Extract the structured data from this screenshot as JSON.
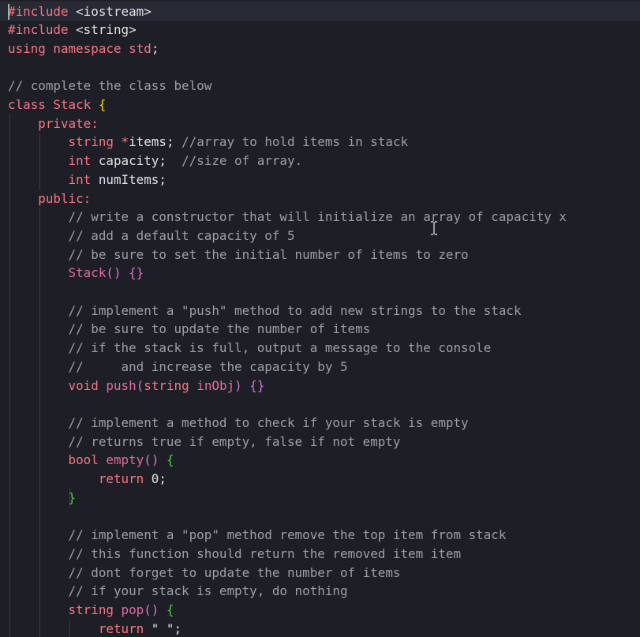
{
  "editor": {
    "language": "cpp",
    "lines": [
      [
        {
          "t": "#include",
          "c": "pp"
        },
        {
          "t": " <iostream>",
          "c": "id"
        }
      ],
      [
        {
          "t": "#include",
          "c": "pp"
        },
        {
          "t": " <string>",
          "c": "id"
        }
      ],
      [
        {
          "t": "using",
          "c": "kw"
        },
        {
          "t": " ",
          "c": "id"
        },
        {
          "t": "namespace",
          "c": "kw"
        },
        {
          "t": " ",
          "c": "id"
        },
        {
          "t": "std",
          "c": "cls"
        },
        {
          "t": ";",
          "c": "pun"
        }
      ],
      [],
      [
        {
          "t": "// complete the class below",
          "c": "com"
        }
      ],
      [
        {
          "t": "class",
          "c": "kw"
        },
        {
          "t": " ",
          "c": "id"
        },
        {
          "t": "Stack",
          "c": "cls"
        },
        {
          "t": " ",
          "c": "id"
        },
        {
          "t": "{",
          "c": "br1"
        }
      ],
      [
        {
          "t": "    ",
          "c": "id"
        },
        {
          "t": "private:",
          "c": "kw"
        }
      ],
      [
        {
          "t": "        ",
          "c": "id"
        },
        {
          "t": "string",
          "c": "type"
        },
        {
          "t": " ",
          "c": "id"
        },
        {
          "t": "*",
          "c": "op"
        },
        {
          "t": "items",
          "c": "id"
        },
        {
          "t": "; ",
          "c": "pun"
        },
        {
          "t": "//array to hold items in stack",
          "c": "com"
        }
      ],
      [
        {
          "t": "        ",
          "c": "id"
        },
        {
          "t": "int",
          "c": "type"
        },
        {
          "t": " capacity",
          "c": "id"
        },
        {
          "t": ";  ",
          "c": "pun"
        },
        {
          "t": "//size of array.",
          "c": "com"
        }
      ],
      [
        {
          "t": "        ",
          "c": "id"
        },
        {
          "t": "int",
          "c": "type"
        },
        {
          "t": " numItems",
          "c": "id"
        },
        {
          "t": ";",
          "c": "pun"
        }
      ],
      [
        {
          "t": "    ",
          "c": "id"
        },
        {
          "t": "public:",
          "c": "kw"
        }
      ],
      [
        {
          "t": "        ",
          "c": "id"
        },
        {
          "t": "// write a constructor that will initialize an array of capacity x",
          "c": "com"
        }
      ],
      [
        {
          "t": "        ",
          "c": "id"
        },
        {
          "t": "// add a default capacity of 5",
          "c": "com"
        }
      ],
      [
        {
          "t": "        ",
          "c": "id"
        },
        {
          "t": "// be sure to set the initial number of items to zero",
          "c": "com"
        }
      ],
      [
        {
          "t": "        ",
          "c": "id"
        },
        {
          "t": "Stack",
          "c": "fn"
        },
        {
          "t": "()",
          "c": "br2"
        },
        {
          "t": " ",
          "c": "id"
        },
        {
          "t": "{}",
          "c": "br2"
        }
      ],
      [],
      [
        {
          "t": "        ",
          "c": "id"
        },
        {
          "t": "// implement a \"push\" method to add new strings to the stack",
          "c": "com"
        }
      ],
      [
        {
          "t": "        ",
          "c": "id"
        },
        {
          "t": "// be sure to update the number of items",
          "c": "com"
        }
      ],
      [
        {
          "t": "        ",
          "c": "id"
        },
        {
          "t": "// if the stack is full, output a message to the console",
          "c": "com"
        }
      ],
      [
        {
          "t": "        ",
          "c": "id"
        },
        {
          "t": "//     and increase the capacity by 5",
          "c": "com"
        }
      ],
      [
        {
          "t": "        ",
          "c": "id"
        },
        {
          "t": "void",
          "c": "type"
        },
        {
          "t": " ",
          "c": "id"
        },
        {
          "t": "push",
          "c": "fn"
        },
        {
          "t": "(",
          "c": "br2"
        },
        {
          "t": "string",
          "c": "type"
        },
        {
          "t": " ",
          "c": "id"
        },
        {
          "t": "inObj",
          "c": "fn"
        },
        {
          "t": ")",
          "c": "br2"
        },
        {
          "t": " ",
          "c": "id"
        },
        {
          "t": "{}",
          "c": "br2"
        }
      ],
      [],
      [
        {
          "t": "        ",
          "c": "id"
        },
        {
          "t": "// implement a method to check if your stack is empty",
          "c": "com"
        }
      ],
      [
        {
          "t": "        ",
          "c": "id"
        },
        {
          "t": "// returns true if empty, false if not empty",
          "c": "com"
        }
      ],
      [
        {
          "t": "        ",
          "c": "id"
        },
        {
          "t": "bool",
          "c": "type"
        },
        {
          "t": " ",
          "c": "id"
        },
        {
          "t": "empty",
          "c": "fn"
        },
        {
          "t": "()",
          "c": "br2"
        },
        {
          "t": " ",
          "c": "id"
        },
        {
          "t": "{",
          "c": "br3"
        }
      ],
      [
        {
          "t": "            ",
          "c": "id"
        },
        {
          "t": "return",
          "c": "kw"
        },
        {
          "t": " ",
          "c": "id"
        },
        {
          "t": "0",
          "c": "num"
        },
        {
          "t": ";",
          "c": "pun"
        }
      ],
      [
        {
          "t": "        ",
          "c": "id"
        },
        {
          "t": "}",
          "c": "br3"
        }
      ],
      [],
      [
        {
          "t": "        ",
          "c": "id"
        },
        {
          "t": "// implement a \"pop\" method remove the top item from stack",
          "c": "com"
        }
      ],
      [
        {
          "t": "        ",
          "c": "id"
        },
        {
          "t": "// this function should return the removed item item",
          "c": "com"
        }
      ],
      [
        {
          "t": "        ",
          "c": "id"
        },
        {
          "t": "// dont forget to update the number of items",
          "c": "com"
        }
      ],
      [
        {
          "t": "        ",
          "c": "id"
        },
        {
          "t": "// if your stack is empty, do nothing",
          "c": "com"
        }
      ],
      [
        {
          "t": "        ",
          "c": "id"
        },
        {
          "t": "string",
          "c": "type"
        },
        {
          "t": " ",
          "c": "id"
        },
        {
          "t": "pop",
          "c": "fn"
        },
        {
          "t": "()",
          "c": "br2"
        },
        {
          "t": " ",
          "c": "id"
        },
        {
          "t": "{",
          "c": "br3"
        }
      ],
      [
        {
          "t": "            ",
          "c": "id"
        },
        {
          "t": "return",
          "c": "kw"
        },
        {
          "t": " ",
          "c": "id"
        },
        {
          "t": "\" \"",
          "c": "str"
        },
        {
          "t": ";",
          "c": "pun"
        }
      ]
    ]
  },
  "colors": {
    "background": "#1e1f26",
    "keyword": "#f97583",
    "function": "#e06c9f",
    "comment": "#9aa0a6",
    "text": "#e2e2e2",
    "bracket_gold": "#ffd700",
    "bracket_orchid": "#da70d6",
    "bracket_green": "#4ec94e"
  },
  "cursor_icon": "text-ibeam-icon"
}
